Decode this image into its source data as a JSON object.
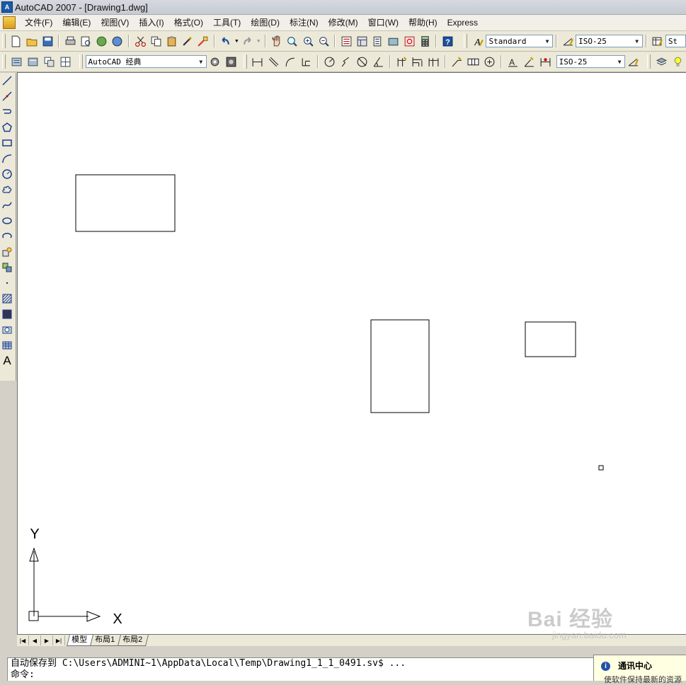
{
  "window": {
    "title": "AutoCAD 2007 - [Drawing1.dwg]"
  },
  "menu": [
    "文件(F)",
    "编辑(E)",
    "视图(V)",
    "插入(I)",
    "格式(O)",
    "工具(T)",
    "绘图(D)",
    "标注(N)",
    "修改(M)",
    "窗口(W)",
    "帮助(H)",
    "Express"
  ],
  "toolbar1": {
    "text_style": "Standard",
    "dim_style": "ISO-25",
    "table_style": "St"
  },
  "toolbar2": {
    "workspace": "AutoCAD 经典",
    "dim_style": "ISO-25"
  },
  "left_toolbar": {
    "text_tool_label": "A"
  },
  "ucs": {
    "x_label": "X",
    "y_label": "Y"
  },
  "layout_tabs": [
    "模型",
    "布局1",
    "布局2"
  ],
  "command": {
    "line1": "自动保存到 C:\\Users\\ADMINI~1\\AppData\\Local\\Temp\\Drawing1_1_1_0491.sv$ ...",
    "line2": "命令:"
  },
  "notification": {
    "title": "通讯中心",
    "body": "使软件保持最新的资源"
  },
  "watermark": {
    "brand": "Bai 经验",
    "sub": "jingyan.baidu.com"
  },
  "colors": {
    "canvas": "#ffffff",
    "chrome": "#ece9d8",
    "title_bar": "#c6cad2"
  }
}
